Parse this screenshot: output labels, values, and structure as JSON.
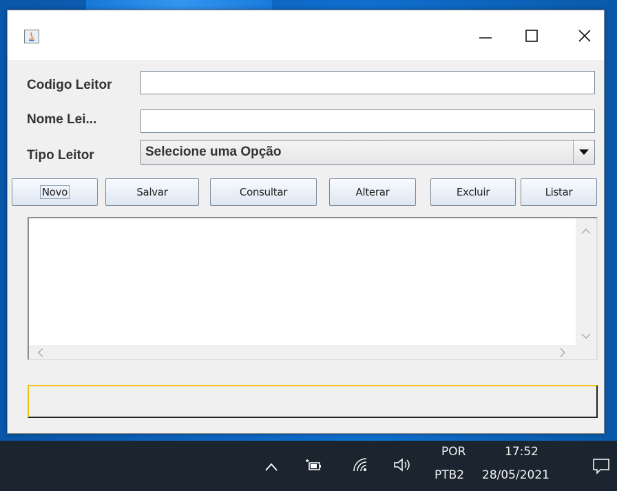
{
  "form": {
    "codigo_label": "Codigo Leitor",
    "codigo_value": "",
    "nome_label": "Nome Lei...",
    "nome_value": "",
    "tipo_label": "Tipo Leitor",
    "tipo_selected": "Selecione uma Opção"
  },
  "buttons": {
    "novo": "Novo",
    "salvar": "Salvar",
    "consultar": "Consultar",
    "alterar": "Alterar",
    "excluir": "Excluir",
    "listar": "Listar"
  },
  "taskbar": {
    "language_top": "POR",
    "language_bottom": "PTB2",
    "time": "17:52",
    "date": "28/05/2021"
  },
  "colors": {
    "status_highlight": "#f5c21a",
    "taskbar_bg": "#1b2530",
    "window_bg": "#f0f0f0"
  },
  "icons": [
    "java-app-icon",
    "minimize-icon",
    "maximize-icon",
    "close-icon",
    "dropdown-arrow-icon",
    "scroll-up-icon",
    "scroll-down-icon",
    "scroll-left-icon",
    "scroll-right-icon",
    "chevron-up-icon",
    "battery-plug-icon",
    "wifi-icon",
    "speaker-icon",
    "notification-icon"
  ]
}
